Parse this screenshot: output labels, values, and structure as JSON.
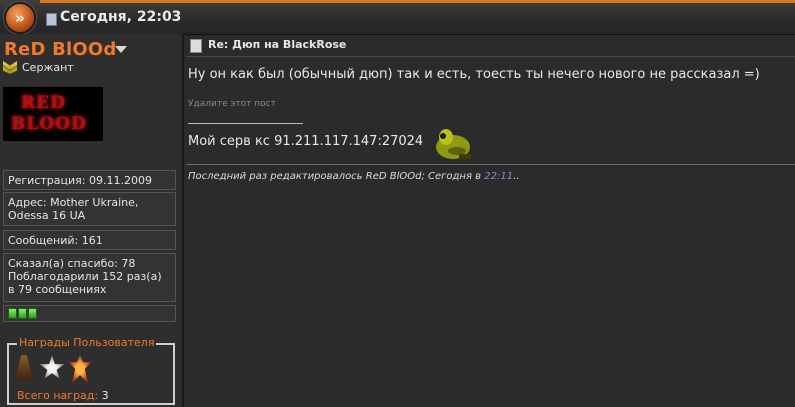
{
  "header": {
    "date": "Сегодня, 22:03"
  },
  "user": {
    "name": "ReD BlOOd",
    "rank": "Сержант",
    "avatar_line1": "RED",
    "avatar_line2": "BLOOD",
    "registration": "Регистрация: 09.11.2009",
    "address": "Адрес: Mother Ukraine, Odessa 16 UA",
    "posts": "Сообщений: 161",
    "thanks": "Сказал(а) спасибо: 78 Поблагодарили 152 раз(а) в 79 сообщениях",
    "reputation_pips": 3,
    "awards": {
      "title": "Награды Пользователя",
      "total_label": "Всего наград:",
      "total_count": "3"
    }
  },
  "post": {
    "title": "Re: Дюп на BlackRose",
    "text": "Ну он как был (обычный дюп) так и есть, тоесть ты нечего нового не рассказал =)",
    "delete_link": "Удалите этот пост",
    "signature": "Мой серв кс 91.211.117.147:27024",
    "edit_prefix": "Последний раз редактировалось ReD BlOOd; Сегодня в ",
    "edit_time": "22:11",
    "edit_suffix": ".."
  },
  "colors": {
    "accent": "#f07a2a",
    "edit_time": "#8a8fc8"
  }
}
